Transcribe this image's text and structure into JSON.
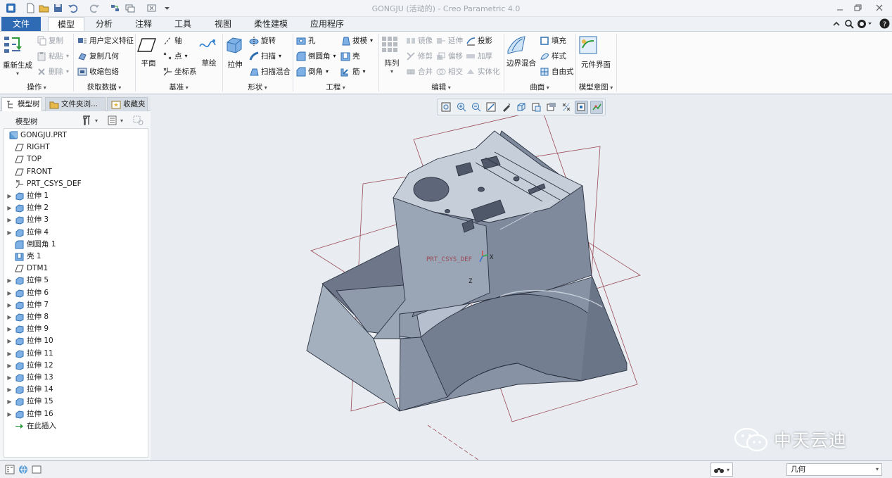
{
  "window": {
    "title": "GONGJU (活动的) - Creo Parametric 4.0"
  },
  "tabs": [
    {
      "label": "文件"
    },
    {
      "label": "模型"
    },
    {
      "label": "分析"
    },
    {
      "label": "注释"
    },
    {
      "label": "工具"
    },
    {
      "label": "视图"
    },
    {
      "label": "柔性建模"
    },
    {
      "label": "应用程序"
    }
  ],
  "ribbon": {
    "operations": {
      "label": "操作",
      "regenerate": "重新生成",
      "copy": "复制",
      "paste": "粘贴",
      "delete": "删除"
    },
    "get_data": {
      "label": "获取数据",
      "udf": "用户定义特征",
      "copy_geom": "复制几何",
      "shrinkwrap": "收缩包络"
    },
    "datum": {
      "label": "基准",
      "plane": "平面",
      "axis": "轴",
      "point": "点",
      "csys": "坐标系",
      "sketch": "草绘"
    },
    "shapes": {
      "label": "形状",
      "extrude": "拉伸",
      "revolve": "旋转",
      "sweep": "扫描",
      "swept_blend": "扫描混合"
    },
    "engineering": {
      "label": "工程",
      "hole": "孔",
      "round": "倒圆角",
      "chamfer": "倒角",
      "draft": "拔模",
      "shell": "壳",
      "rib": "筋"
    },
    "editing": {
      "label": "编辑",
      "pattern": "阵列",
      "mirror": "镜像",
      "extend": "延伸",
      "project": "投影",
      "trim": "修剪",
      "offset": "偏移",
      "thicken": "加厚",
      "merge": "合并",
      "intersect": "相交",
      "solidify": "实体化"
    },
    "surfaces": {
      "label": "曲面",
      "boundary_blend": "边界混合",
      "fill": "填充",
      "style": "样式",
      "freestyle": "自由式"
    },
    "model_intent": {
      "label": "模型意图",
      "component_interface": "元件界面"
    }
  },
  "left_panel": {
    "tabs": [
      {
        "label": "模型树"
      },
      {
        "label": "文件夹浏..."
      },
      {
        "label": "收藏夹"
      }
    ],
    "tree_header": "模型树",
    "items": [
      {
        "label": "GONGJU.PRT",
        "type": "part"
      },
      {
        "label": "RIGHT",
        "type": "plane"
      },
      {
        "label": "TOP",
        "type": "plane"
      },
      {
        "label": "FRONT",
        "type": "plane"
      },
      {
        "label": "PRT_CSYS_DEF",
        "type": "csys"
      },
      {
        "label": "拉伸 1",
        "type": "extrude"
      },
      {
        "label": "拉伸 2",
        "type": "extrude"
      },
      {
        "label": "拉伸 3",
        "type": "extrude"
      },
      {
        "label": "拉伸 4",
        "type": "extrude"
      },
      {
        "label": "倒圆角 1",
        "type": "round"
      },
      {
        "label": "壳 1",
        "type": "shell"
      },
      {
        "label": "DTM1",
        "type": "plane"
      },
      {
        "label": "拉伸 5",
        "type": "extrude"
      },
      {
        "label": "拉伸 6",
        "type": "extrude"
      },
      {
        "label": "拉伸 7",
        "type": "extrude"
      },
      {
        "label": "拉伸 8",
        "type": "extrude"
      },
      {
        "label": "拉伸 9",
        "type": "extrude"
      },
      {
        "label": "拉伸 10",
        "type": "extrude"
      },
      {
        "label": "拉伸 11",
        "type": "extrude"
      },
      {
        "label": "拉伸 12",
        "type": "extrude"
      },
      {
        "label": "拉伸 13",
        "type": "extrude"
      },
      {
        "label": "拉伸 14",
        "type": "extrude"
      },
      {
        "label": "拉伸 15",
        "type": "extrude"
      },
      {
        "label": "拉伸 16",
        "type": "extrude"
      },
      {
        "label": "在此插入",
        "type": "insert"
      }
    ]
  },
  "viewport": {
    "csys_label": "PRT_CSYS_DEF",
    "axis_x": "X",
    "axis_z": "Z"
  },
  "status": {
    "filter_value": "几何"
  },
  "watermark": {
    "text": "中天云迪"
  },
  "colors": {
    "accent": "#2e6bb4",
    "model_face": "#9aa5b6",
    "datum": "#9b4b56",
    "background": "#e9edf2"
  }
}
